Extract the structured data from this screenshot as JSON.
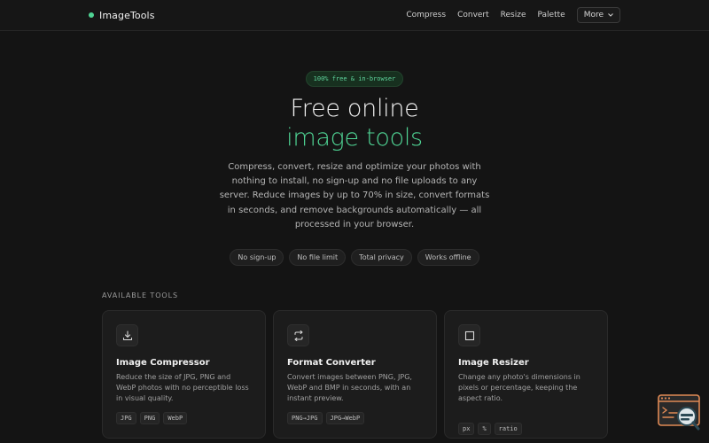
{
  "nav": {
    "brand": "ImageTools",
    "links": [
      "Compress",
      "Convert",
      "Resize",
      "Palette"
    ],
    "more_label": "More"
  },
  "hero": {
    "badge": "100% free & in-browser",
    "title_line1": "Free online",
    "title_line2": "image tools",
    "description": "Compress, convert, resize and optimize your photos with nothing to install, no sign-up and no file uploads to any server. Reduce images by up to 70% in size, convert formats in seconds, and remove backgrounds automatically — all processed in your browser.",
    "chips": [
      "No sign-up",
      "No file limit",
      "Total privacy",
      "Works offline"
    ]
  },
  "tools": {
    "section_label": "AVAILABLE TOOLS",
    "cards": [
      {
        "icon": "download-icon",
        "title": "Image Compressor",
        "description": "Reduce the size of JPG, PNG and WebP photos with no perceptible loss in visual quality.",
        "tags": [
          "JPG",
          "PNG",
          "WebP"
        ]
      },
      {
        "icon": "swap-arrows-icon",
        "title": "Format Converter",
        "description": "Convert images between PNG, JPG, WebP and BMP in seconds, with an instant preview.",
        "tags": [
          "PNG→JPG",
          "JPG→WebP"
        ]
      },
      {
        "icon": "square-icon",
        "title": "Image Resizer",
        "description": "Change any photo's dimensions in pixels or percentage, keeping the aspect ratio.",
        "tags": [
          "px",
          "%",
          "ratio"
        ]
      }
    ]
  },
  "colors": {
    "accent": "#4fd494",
    "background": "#141414",
    "card": "#1c1c1c"
  }
}
